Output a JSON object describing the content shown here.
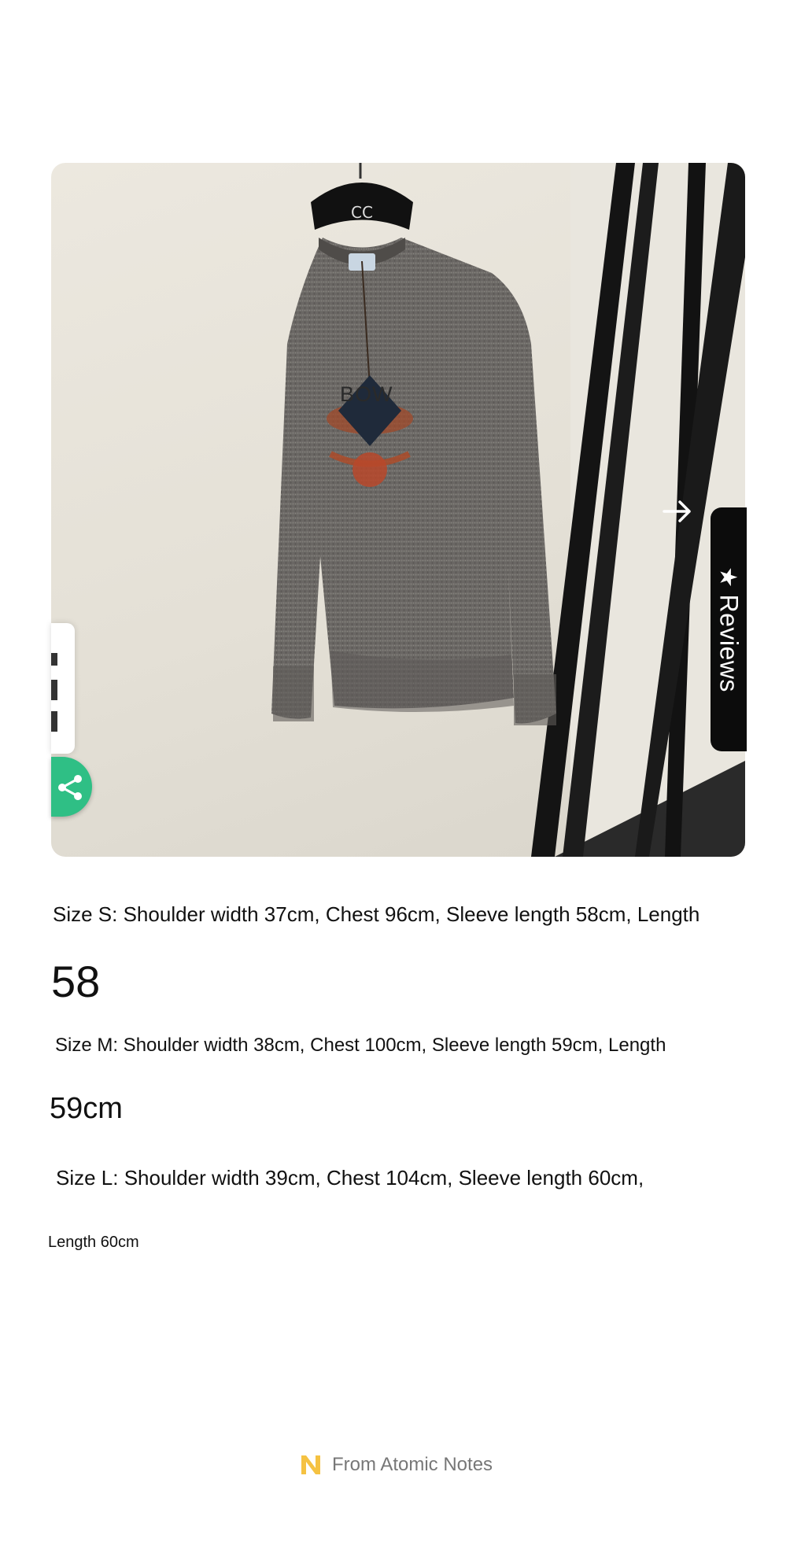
{
  "product_image": {
    "tag_text": "BOW"
  },
  "reviews_tab": {
    "icon": "star-icon",
    "label": "Reviews"
  },
  "share_button": {
    "icon": "share-icon",
    "color": "#2fbf85"
  },
  "sizes": {
    "s_line": "Size S: Shoulder width 37cm, Chest 96cm, Sleeve length 58cm, Length",
    "s_value": "58",
    "m_line": "Size M: Shoulder width 38cm, Chest 100cm, Sleeve length 59cm, Length",
    "m_value": "59cm",
    "l_line": "Size L: Shoulder width 39cm, Chest 104cm, Sleeve length 60cm,",
    "l_value": "Length 60cm"
  },
  "footer": {
    "logo": "atomic-notes-logo",
    "logo_color": "#f5c242",
    "text": "From Atomic Notes"
  }
}
